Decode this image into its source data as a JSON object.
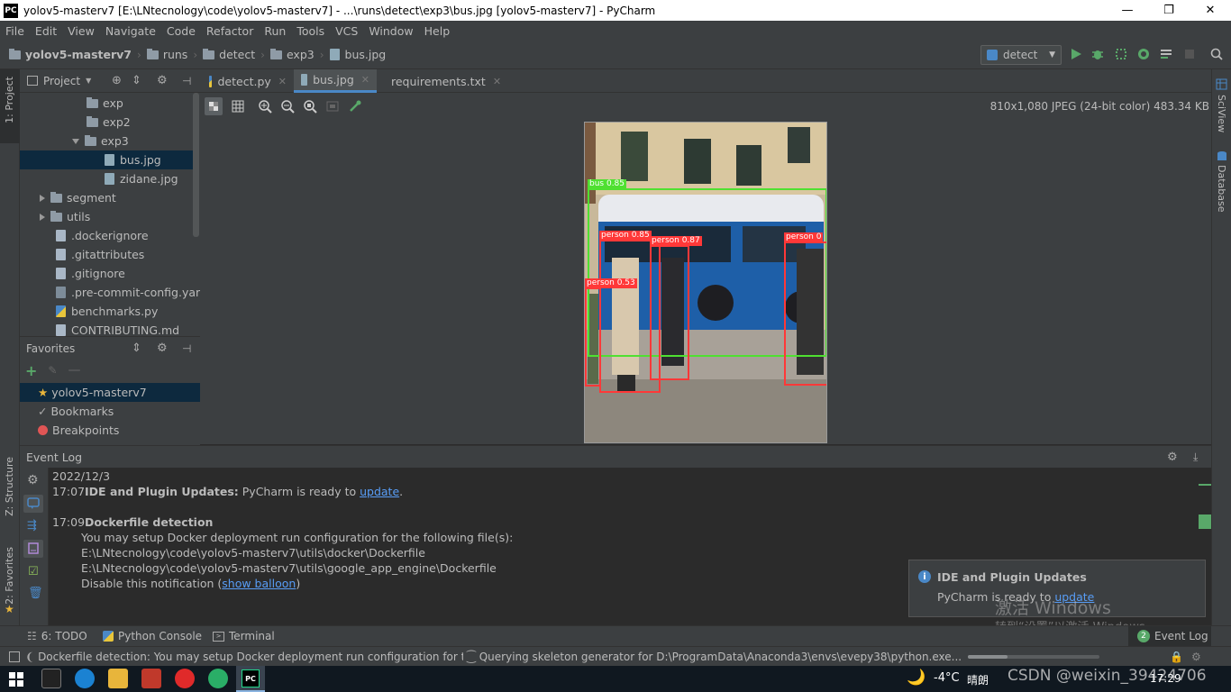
{
  "window": {
    "title": "yolov5-masterv7 [E:\\LNtecnology\\code\\yolov5-masterv7] - ...\\runs\\detect\\exp3\\bus.jpg [yolov5-masterv7] - PyCharm",
    "logo": "PC",
    "controls": {
      "minimize": "—",
      "maximize": "❐",
      "close": "✕"
    }
  },
  "menu": [
    "File",
    "Edit",
    "View",
    "Navigate",
    "Code",
    "Refactor",
    "Run",
    "Tools",
    "VCS",
    "Window",
    "Help"
  ],
  "breadcrumbs": [
    "yolov5-masterv7",
    "runs",
    "detect",
    "exp3",
    "bus.jpg"
  ],
  "run_config": {
    "name": "detect"
  },
  "left_tool_windows": {
    "project": "1: Project",
    "structure": "Z: Structure",
    "favorites": "2: Favorites"
  },
  "right_tool_windows": {
    "sciview": "SciView",
    "database": "Database"
  },
  "project_panel": {
    "title": "Project",
    "items": [
      {
        "label": "exp",
        "type": "folder",
        "level": 3,
        "expanded": null
      },
      {
        "label": "exp2",
        "type": "folder",
        "level": 3,
        "expanded": null
      },
      {
        "label": "exp3",
        "type": "folder",
        "level": 3,
        "expanded": true
      },
      {
        "label": "bus.jpg",
        "type": "image",
        "level": 4,
        "selected": true
      },
      {
        "label": "zidane.jpg",
        "type": "image",
        "level": 4
      },
      {
        "label": "segment",
        "type": "folder",
        "level": 1,
        "expanded": false
      },
      {
        "label": "utils",
        "type": "folder",
        "level": 1,
        "expanded": false
      },
      {
        "label": ".dockerignore",
        "type": "file",
        "level": 1
      },
      {
        "label": ".gitattributes",
        "type": "file",
        "level": 1
      },
      {
        "label": ".gitignore",
        "type": "file",
        "level": 1
      },
      {
        "label": ".pre-commit-config.yaml",
        "type": "yaml",
        "level": 1
      },
      {
        "label": "benchmarks.py",
        "type": "python",
        "level": 1
      },
      {
        "label": "CONTRIBUTING.md",
        "type": "file",
        "level": 1
      }
    ]
  },
  "favorites_panel": {
    "title": "Favorites",
    "items": [
      {
        "label": "yolov5-masterv7",
        "icon": "star-icon"
      },
      {
        "label": "Bookmarks",
        "icon": "check-icon"
      },
      {
        "label": "Breakpoints",
        "icon": "breakpoint-icon"
      }
    ]
  },
  "editor_tabs": [
    {
      "label": "detect.py",
      "active": false
    },
    {
      "label": "bus.jpg",
      "active": true
    },
    {
      "label": "requirements.txt",
      "active": false
    }
  ],
  "image_info": "810x1,080 JPEG (24-bit color) 483.34 KB",
  "detections": [
    {
      "label": "bus 0.85",
      "color": "#4fe031"
    },
    {
      "label": "person 0.85",
      "color": "#ff3838"
    },
    {
      "label": "person 0.87",
      "color": "#ff3838"
    },
    {
      "label": "person 0",
      "color": "#ff3838"
    },
    {
      "label": "person 0.53",
      "color": "#ff3838"
    }
  ],
  "event_log": {
    "title": "Event Log",
    "date": "2022/12/3",
    "entries": [
      {
        "time": "17:07",
        "title": "IDE and Plugin Updates:",
        "text": " PyCharm is ready to ",
        "link": "update",
        "tail": "."
      },
      {
        "time": "17:09",
        "title": "Dockerfile detection",
        "lines": [
          "You may setup Docker deployment run configuration for the following file(s):",
          "E:\\LNtecnology\\code\\yolov5-masterv7\\utils\\docker\\Dockerfile",
          "E:\\LNtecnology\\code\\yolov5-masterv7\\utils\\google_app_engine\\Dockerfile"
        ],
        "disable_prefix": "Disable this notification (",
        "disable_link": "show balloon",
        "disable_suffix": ")"
      }
    ]
  },
  "notification": {
    "title": "IDE and Plugin Updates",
    "text": "PyCharm is ready to ",
    "link": "update",
    "watermark1": "激活 Windows",
    "watermark2": "转到“设置”以激活 Windows。"
  },
  "bottom_tabs": [
    "6: TODO",
    "Python Console",
    "Terminal"
  ],
  "bottom_right": "Event Log",
  "bottom_badge": "2",
  "status": {
    "left": "Dockerfile detection: You may setup Docker deployment run configuration for t...",
    "mid": "Querying skeleton generator for D:\\ProgramData\\Anaconda3\\envs\\evepy38\\python.exe..."
  },
  "taskbar": {
    "weather": "-4°C",
    "weather_text": "晴朗",
    "time": "17:29",
    "watermark": "CSDN @weixin_39424706"
  },
  "colors": {
    "accent": "#4a88c7",
    "link": "#589df6",
    "run_green": "#59a869",
    "bbox_red": "#ff3838",
    "bbox_green": "#4fe031"
  }
}
